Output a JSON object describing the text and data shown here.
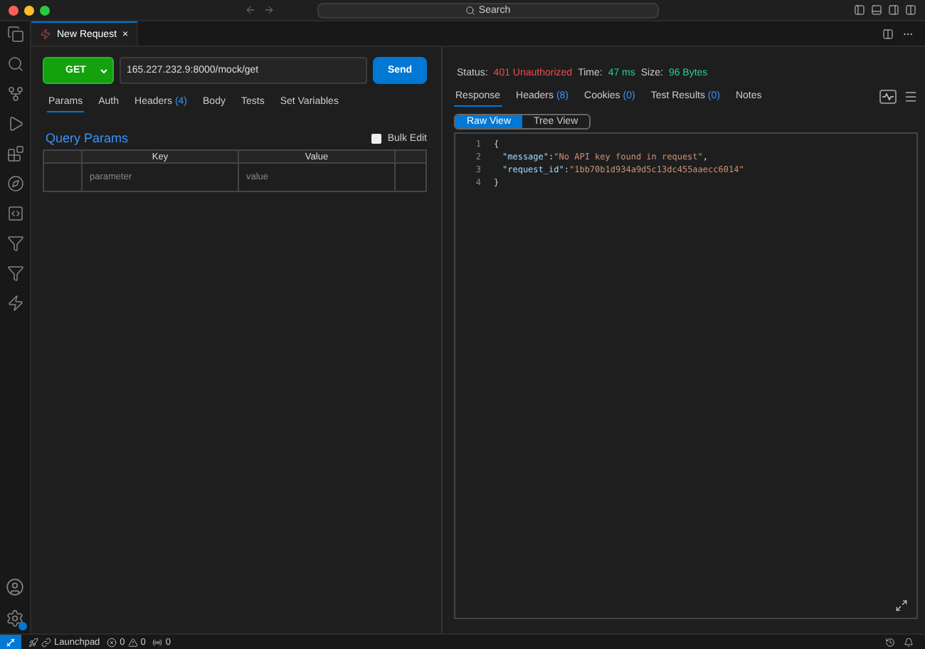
{
  "title_bar": {
    "search": "Search"
  },
  "editor_tabs": [
    {
      "label": "New Request",
      "selected": true,
      "close": "×"
    }
  ],
  "request": {
    "method": "GET",
    "url": "165.227.232.9:8000/mock/get",
    "send": "Send"
  },
  "request_tabs": [
    {
      "label": "Params",
      "selected": true
    },
    {
      "label": "Auth",
      "selected": false
    },
    {
      "label": "Headers",
      "count": "(4)",
      "selected": false
    },
    {
      "label": "Body",
      "selected": false
    },
    {
      "label": "Tests",
      "selected": false
    },
    {
      "label": "Set Variables",
      "selected": false
    }
  ],
  "query_params": {
    "title": "Query Params",
    "bulk_edit": {
      "label": "Bulk Edit",
      "checked": false
    },
    "columns": [
      "Key",
      "Value"
    ],
    "rows": [
      {
        "key": "parameter",
        "value": "value"
      }
    ]
  },
  "response": {
    "status_label": "Status:",
    "status": "401 Unauthorized",
    "time_label": "Time:",
    "time": "47 ms",
    "size_label": "Size:",
    "size": "96 Bytes",
    "tabs": [
      {
        "label": "Response",
        "selected": true
      },
      {
        "label": "Headers",
        "count": "(8)",
        "selected": false
      },
      {
        "label": "Cookies",
        "count": "(0)",
        "selected": false
      },
      {
        "label": "Test Results",
        "count": "(0)",
        "selected": false
      },
      {
        "label": "Notes",
        "selected": false
      }
    ],
    "views": [
      {
        "label": "Raw View",
        "selected": true
      },
      {
        "label": "Tree View",
        "selected": false
      }
    ],
    "lines": [
      {
        "number": "1",
        "tokens": [
          {
            "kind": "punct",
            "text": "{"
          }
        ]
      },
      {
        "number": "2",
        "tokens": [
          {
            "kind": "key",
            "text": "\"message\""
          },
          {
            "kind": "punct",
            "text": ":"
          },
          {
            "kind": "string",
            "text": "\"No API key found in request\""
          },
          {
            "kind": "punct",
            "text": ","
          }
        ]
      },
      {
        "number": "3",
        "tokens": [
          {
            "kind": "key",
            "text": "\"request_id\""
          },
          {
            "kind": "punct",
            "text": ":"
          },
          {
            "kind": "string",
            "text": "\"1bb70b1d934a9d5c13dc455aaecc6014\""
          }
        ]
      },
      {
        "number": "4",
        "tokens": [
          {
            "kind": "punct",
            "text": "}"
          }
        ]
      }
    ]
  },
  "status_bar": {
    "launchpad": "Launchpad",
    "errors": "0",
    "warnings": "0",
    "ports": "0"
  }
}
